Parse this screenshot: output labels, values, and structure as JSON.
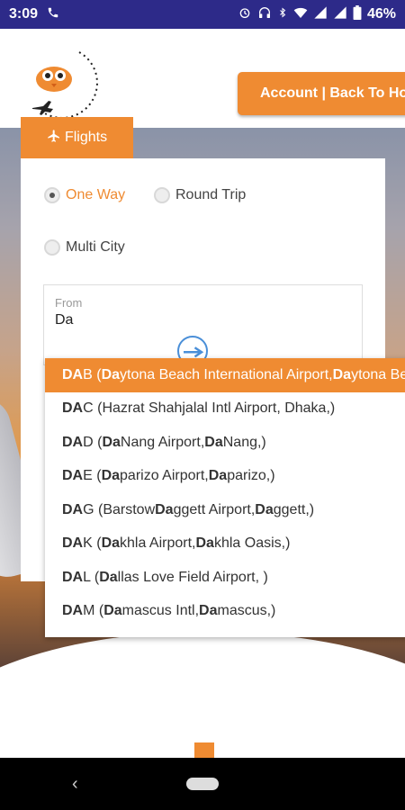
{
  "status_bar": {
    "time": "3:09",
    "battery": "46%"
  },
  "header": {
    "account_button": "Account | Back To Home"
  },
  "tabs": {
    "flights": "Flights"
  },
  "trip_type": {
    "one_way": "One Way",
    "round_trip": "Round Trip",
    "multi_city": "Multi City",
    "selected": "One Way"
  },
  "from_field": {
    "label": "From",
    "value": "Da"
  },
  "suggestions": [
    {
      "code_bold": "DA",
      "code_rest": "B",
      "segments": [
        [
          "b",
          "Da"
        ],
        [
          "n",
          "ytona Beach International Airport, "
        ],
        [
          "b",
          "Da"
        ],
        [
          "n",
          "ytona Beach,)"
        ]
      ]
    },
    {
      "code_bold": "DA",
      "code_rest": "C",
      "segments": [
        [
          "n",
          "Hazrat Shahjalal Intl Airport, Dhaka,)"
        ]
      ]
    },
    {
      "code_bold": "DA",
      "code_rest": "D",
      "segments": [
        [
          "b",
          "Da"
        ],
        [
          "n",
          " Nang Airport, "
        ],
        [
          "b",
          "Da"
        ],
        [
          "n",
          " Nang,)"
        ]
      ]
    },
    {
      "code_bold": "DA",
      "code_rest": "E",
      "segments": [
        [
          "b",
          "Da"
        ],
        [
          "n",
          "parizo Airport, "
        ],
        [
          "b",
          "Da"
        ],
        [
          "n",
          "parizo,)"
        ]
      ]
    },
    {
      "code_bold": "DA",
      "code_rest": "G",
      "segments": [
        [
          "n",
          "Barstow "
        ],
        [
          "b",
          "Da"
        ],
        [
          "n",
          "ggett Airport, "
        ],
        [
          "b",
          "Da"
        ],
        [
          "n",
          "ggett,)"
        ]
      ]
    },
    {
      "code_bold": "DA",
      "code_rest": "K",
      "segments": [
        [
          "b",
          "Da"
        ],
        [
          "n",
          "khla Airport, "
        ],
        [
          "b",
          "Da"
        ],
        [
          "n",
          "khla Oasis,)"
        ]
      ]
    },
    {
      "code_bold": "DA",
      "code_rest": "L",
      "segments": [
        [
          "b",
          "Da"
        ],
        [
          "n",
          "llas Love Field Airport, )"
        ]
      ]
    },
    {
      "code_bold": "DA",
      "code_rest": "M",
      "segments": [
        [
          "b",
          "Da"
        ],
        [
          "n",
          "mascus Intl, "
        ],
        [
          "b",
          "Da"
        ],
        [
          "n",
          "mascus,)"
        ]
      ]
    }
  ],
  "colors": {
    "accent": "#ef8b32",
    "status_bar": "#2d2a89"
  },
  "icons": {
    "phone": "phone-icon",
    "alarm": "alarm-icon",
    "headset": "headset-icon",
    "bluetooth": "bluetooth-icon",
    "wifi": "wifi-icon",
    "signal": "signal-icon",
    "battery": "battery-icon",
    "plane": "plane-icon"
  }
}
